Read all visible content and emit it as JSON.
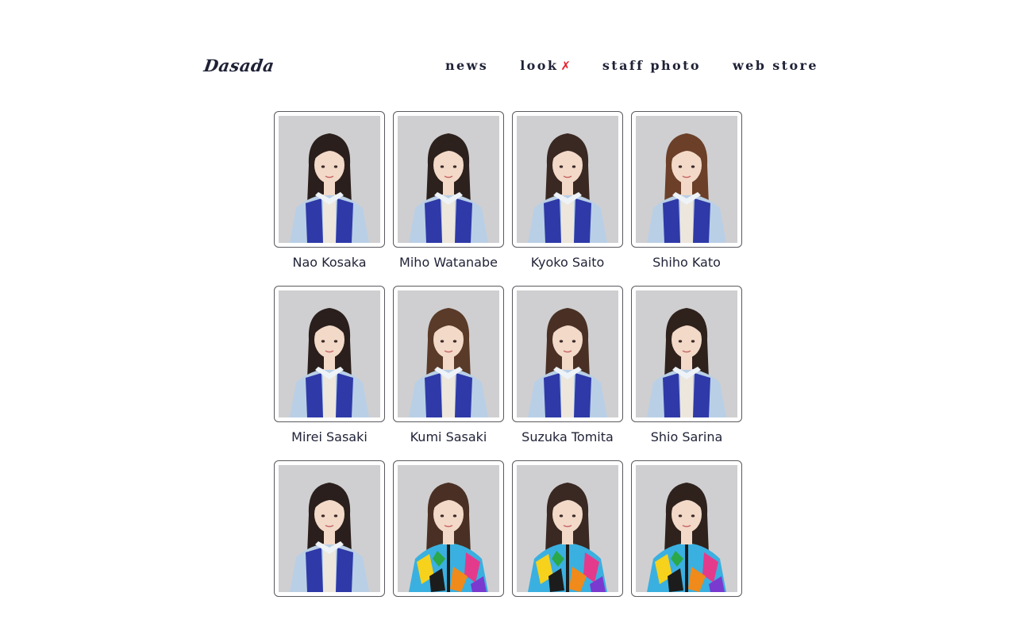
{
  "brand": {
    "logo_text": "Dasada"
  },
  "nav": {
    "items": [
      {
        "label": "news"
      },
      {
        "label": "look"
      },
      {
        "label": "staff photo"
      },
      {
        "label": "web store"
      }
    ],
    "look_mark": "✗",
    "look_mark_color": "#e8202a"
  },
  "colors": {
    "text": "#1f2236",
    "frame_border": "#5a5a60",
    "photo_background": "#c9c9cb"
  },
  "members": [
    {
      "name": "Nao Kosaka",
      "outfit": "blue-uniform",
      "hair": "#2a1f1c"
    },
    {
      "name": "Miho Watanabe",
      "outfit": "blue-uniform",
      "hair": "#2c211d"
    },
    {
      "name": "Kyoko Saito",
      "outfit": "blue-uniform",
      "hair": "#3a2822"
    },
    {
      "name": "Shiho Kato",
      "outfit": "blue-uniform",
      "hair": "#6b3f28"
    },
    {
      "name": "Mirei Sasaki",
      "outfit": "blue-uniform",
      "hair": "#2a1f1c"
    },
    {
      "name": "Kumi Sasaki",
      "outfit": "blue-uniform",
      "hair": "#5a3a28"
    },
    {
      "name": "Suzuka Tomita",
      "outfit": "blue-uniform",
      "hair": "#4a3024"
    },
    {
      "name": "Shio Sarina",
      "outfit": "blue-uniform",
      "hair": "#2f221d"
    },
    {
      "name": "",
      "outfit": "blue-uniform",
      "hair": "#2a1f1c"
    },
    {
      "name": "",
      "outfit": "colorful",
      "hair": "#4a3024"
    },
    {
      "name": "",
      "outfit": "colorful",
      "hair": "#3a2822"
    },
    {
      "name": "",
      "outfit": "colorful",
      "hair": "#2f221d"
    }
  ]
}
